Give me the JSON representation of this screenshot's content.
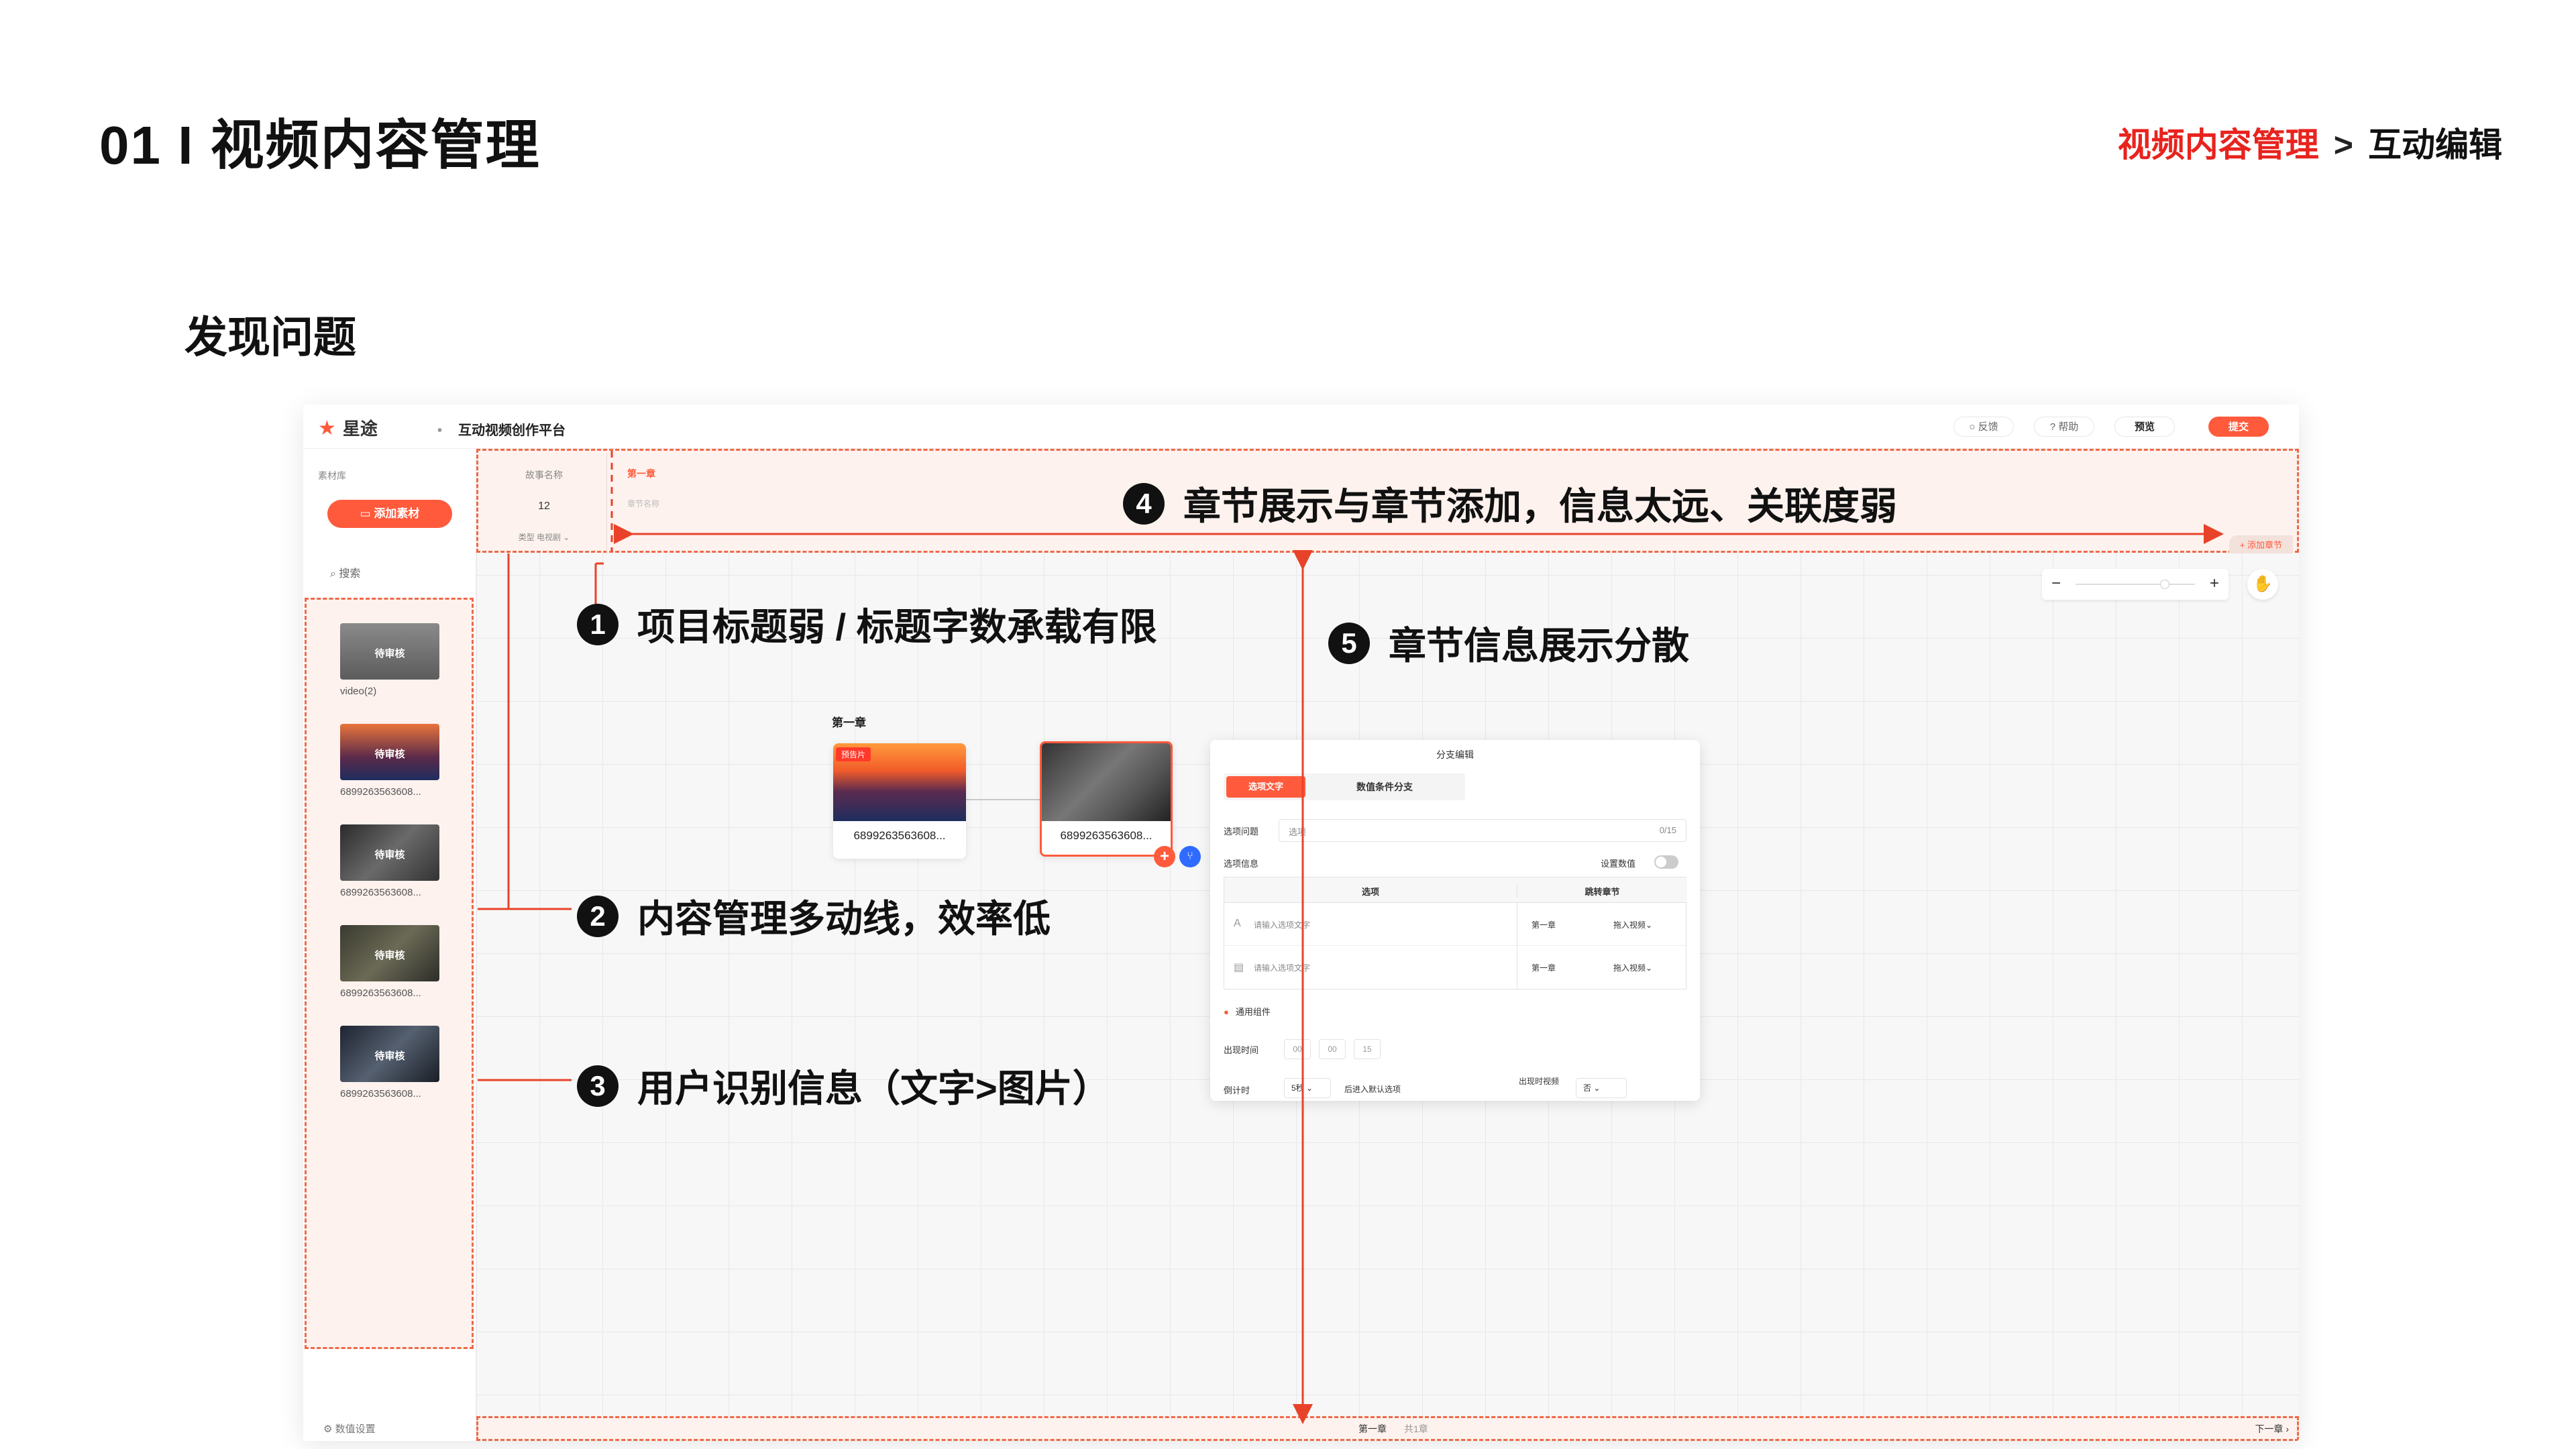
{
  "slide": {
    "title": "01 I 视频内容管理",
    "breadcrumb": {
      "current": "视频内容管理",
      "separator": ">",
      "next": "互动编辑"
    },
    "section": "发现问题"
  },
  "app": {
    "logo": "星途",
    "platform": "互动视频创作平台",
    "topbar": {
      "feedback": "反馈",
      "help": "帮助",
      "preview": "预览",
      "submit": "提交"
    },
    "left": {
      "library_label": "素材库",
      "add_material": "添加素材",
      "search": "搜索",
      "items": [
        {
          "badge": "待审核",
          "caption": "video(2)"
        },
        {
          "badge": "待审核",
          "caption": "6899263563608..."
        },
        {
          "badge": "待审核",
          "caption": "6899263563608..."
        },
        {
          "badge": "待审核",
          "caption": "6899263563608..."
        },
        {
          "badge": "待审核",
          "caption": "6899263563608..."
        }
      ],
      "data_settings": "数值设置"
    },
    "story": {
      "name_label": "故事名称",
      "count": "12",
      "type": "类型 电视剧 ⌄",
      "chapter_tab": "第一章",
      "chapter_name_placeholder": "章节名称",
      "add_chapter": "+ 添加章节"
    },
    "canvas": {
      "chapter_label": "第一章",
      "nodes": [
        {
          "tag": "预告片",
          "caption": "6899263563608..."
        },
        {
          "caption": "6899263563608..."
        }
      ]
    },
    "branch": {
      "title": "分支编辑",
      "tab_text": "选项文字",
      "tab_cond": "数值条件分支",
      "question_label": "选项问题",
      "question_placeholder": "选项",
      "question_count": "0/15",
      "info_label": "选项信息",
      "set_value": "设置数值",
      "col_option": "选项",
      "col_jump": "跳转章节",
      "rows": [
        {
          "icon": "A",
          "placeholder": "请输入选项文字",
          "chapter": "第一章",
          "video": "拖入视频⌄"
        },
        {
          "icon": "▤",
          "placeholder": "请输入选项文字",
          "chapter": "第一章",
          "video": "拖入视频⌄"
        }
      ],
      "generic_component": "通用组件",
      "appear_time": "出现时间",
      "time": [
        "00",
        "00",
        "15"
      ],
      "countdown": "倒计时",
      "countdown_value": "5秒 ⌄",
      "default_option": "后进入默认选项",
      "appear_video": "出现时视频",
      "yn_value": "否 ⌄"
    },
    "bottom": {
      "chapter": "第一章",
      "total": "共1章",
      "next": "下一章 ›"
    }
  },
  "callouts": [
    {
      "num": "1",
      "text": "项目标题弱 / 标题字数承载有限"
    },
    {
      "num": "2",
      "text": "内容管理多动线，效率低"
    },
    {
      "num": "3",
      "text": "用户识别信息（文字>图片）"
    },
    {
      "num": "4",
      "text": "章节展示与章节添加，信息太远、关联度弱"
    },
    {
      "num": "5",
      "text": "章节信息展示分散"
    }
  ],
  "colors": {
    "accent": "#ff5a3c",
    "highlight_red": "#e8231e",
    "dash": "#ee6a4a"
  }
}
